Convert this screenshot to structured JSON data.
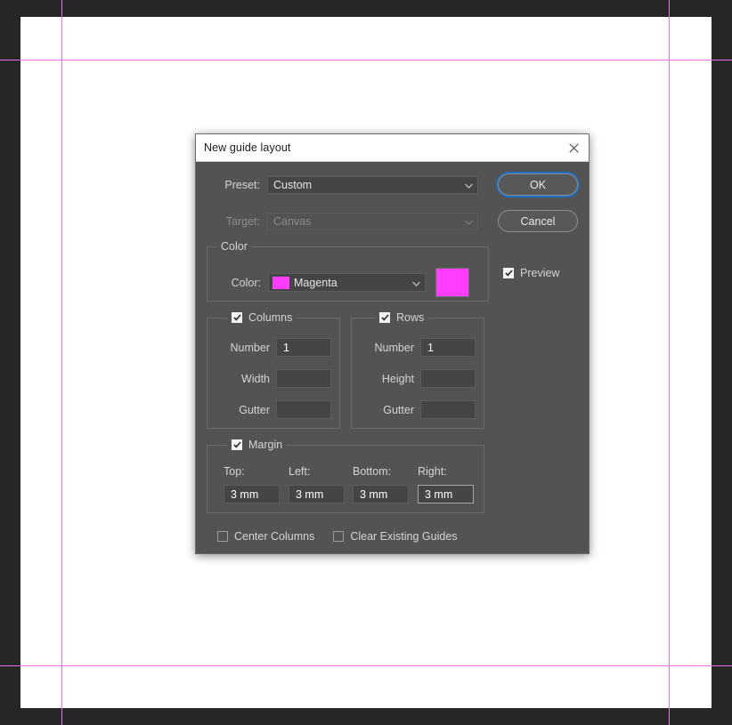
{
  "app": {
    "background_color": "#262626",
    "canvas_color": "#ffffff",
    "guide_color": "#ee6fee"
  },
  "dialog": {
    "title": "New guide layout",
    "close_icon": "close-icon",
    "preset": {
      "label": "Preset:",
      "value": "Custom",
      "options": [
        "Custom"
      ],
      "enabled": true
    },
    "target": {
      "label": "Target:",
      "value": "Canvas",
      "options": [
        "Canvas"
      ],
      "enabled": false
    },
    "buttons": {
      "ok": "OK",
      "cancel": "Cancel"
    },
    "preview": {
      "label": "Preview",
      "checked": true
    },
    "color_group": {
      "legend": "Color",
      "field_label": "Color:",
      "value": "Magenta",
      "options": [
        "Magenta"
      ],
      "swatch_hex": "#ff3dff"
    },
    "columns_group": {
      "legend": "Columns",
      "checked": true,
      "fields": [
        {
          "label": "Number",
          "value": "1"
        },
        {
          "label": "Width",
          "value": ""
        },
        {
          "label": "Gutter",
          "value": ""
        }
      ]
    },
    "rows_group": {
      "legend": "Rows",
      "checked": true,
      "fields": [
        {
          "label": "Number",
          "value": "1"
        },
        {
          "label": "Height",
          "value": ""
        },
        {
          "label": "Gutter",
          "value": ""
        }
      ]
    },
    "margin_group": {
      "legend": "Margin",
      "checked": true,
      "fields": [
        {
          "label": "Top:",
          "value": "3 mm"
        },
        {
          "label": "Left:",
          "value": "3 mm"
        },
        {
          "label": "Bottom:",
          "value": "3 mm"
        },
        {
          "label": "Right:",
          "value": "3 mm"
        }
      ]
    },
    "footer": {
      "center_columns": {
        "label": "Center Columns",
        "checked": false
      },
      "clear_existing_guides": {
        "label": "Clear Existing Guides",
        "checked": false
      }
    }
  }
}
